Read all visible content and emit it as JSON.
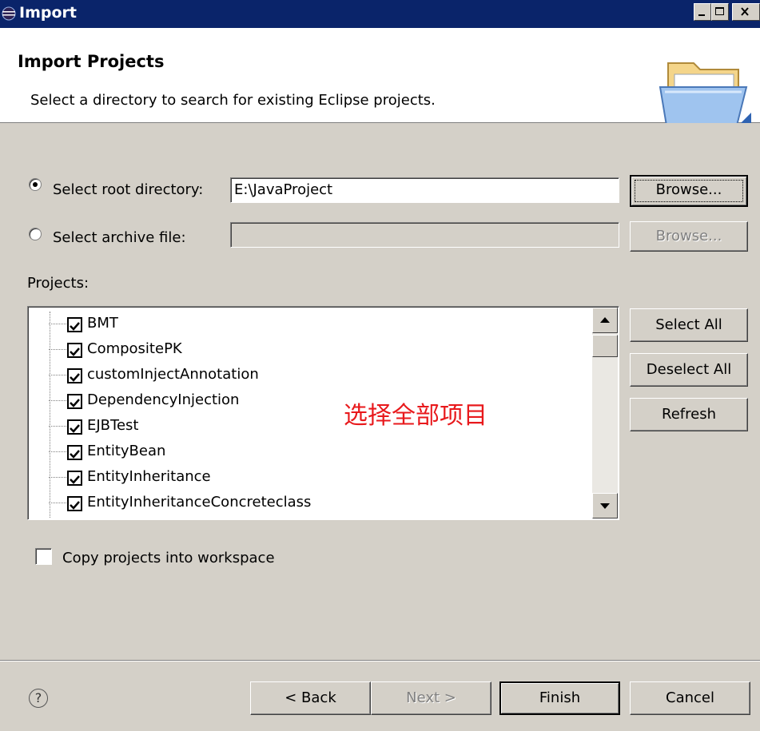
{
  "window": {
    "title": "Import",
    "title_icon": "eclipse-icon",
    "controls": [
      "minimize-icon",
      "maximize-icon",
      "close-icon"
    ]
  },
  "header": {
    "title": "Import Projects",
    "description": "Select a directory to search for existing Eclipse projects.",
    "icon": "folder-icon"
  },
  "source": {
    "root_label": "Select root directory:",
    "root_value": "E:\\JavaProject",
    "root_selected": true,
    "archive_label": "Select archive file:",
    "archive_value": "",
    "archive_selected": false,
    "browse_label": "Browse...",
    "browse_archive_label": "Browse..."
  },
  "projects": {
    "label": "Projects:",
    "items": [
      {
        "name": "BMT",
        "checked": true
      },
      {
        "name": "CompositePK",
        "checked": true
      },
      {
        "name": "customInjectAnnotation",
        "checked": true
      },
      {
        "name": "DependencyInjection",
        "checked": true
      },
      {
        "name": "EJBTest",
        "checked": true
      },
      {
        "name": "EntityBean",
        "checked": true
      },
      {
        "name": "EntityInheritance",
        "checked": true
      },
      {
        "name": "EntityInheritanceConcreteclass",
        "checked": true
      }
    ],
    "select_all_label": "Select All",
    "deselect_all_label": "Deselect All",
    "refresh_label": "Refresh"
  },
  "annotation": "选择全部项目",
  "copy_option": {
    "label": "Copy projects into workspace",
    "checked": false
  },
  "footer": {
    "help_icon": "help-icon",
    "back_label": "< Back",
    "next_label": "Next >",
    "finish_label": "Finish",
    "cancel_label": "Cancel"
  },
  "colors": {
    "title_bar": "#0a246a",
    "dialog_face": "#d4d0c8",
    "annotation": "#e8191c"
  }
}
